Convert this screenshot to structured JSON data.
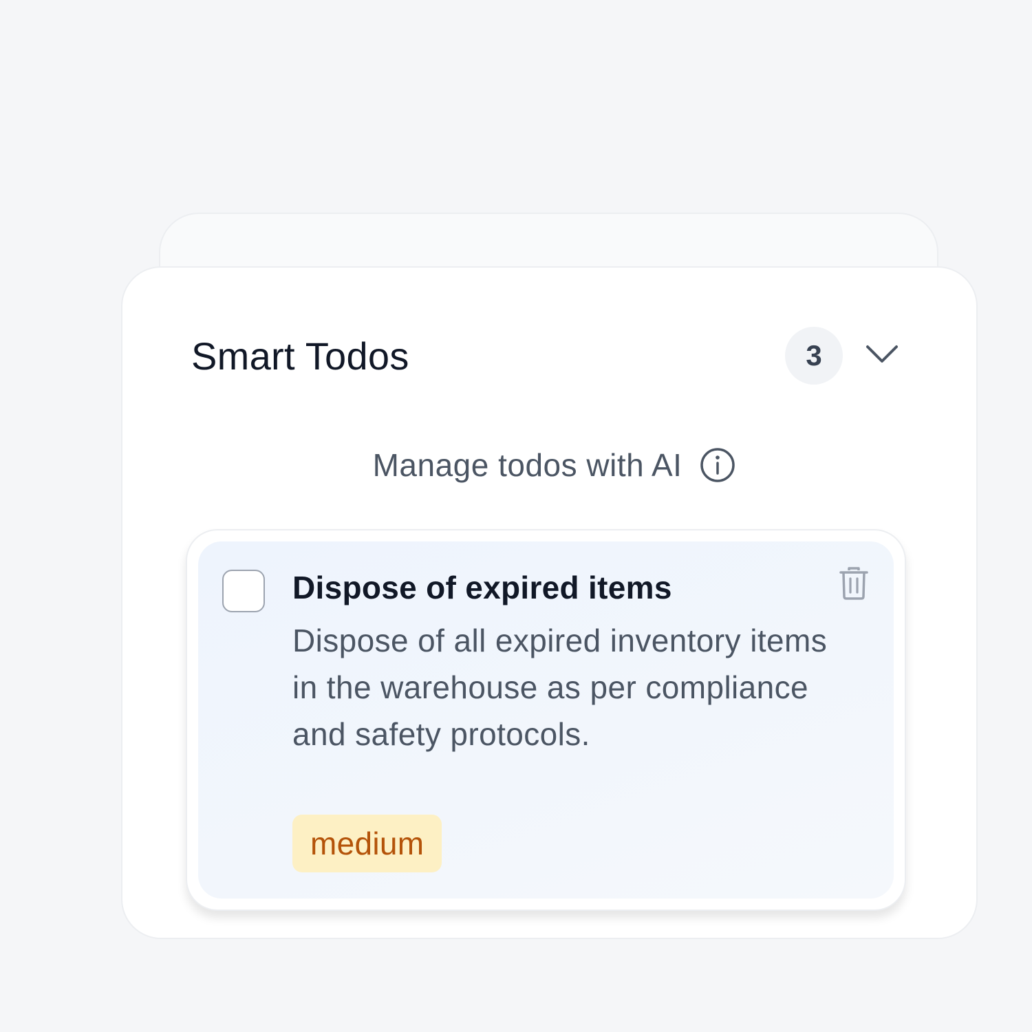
{
  "panel": {
    "title": "Smart Todos",
    "count": "3",
    "subtitle": "Manage todos with AI"
  },
  "icons": {
    "collapse": "chevron-down-icon",
    "info": "info-icon",
    "delete": "trash-icon"
  },
  "todos": [
    {
      "title": "Dispose of expired items",
      "description": "Dispose of all expired inventory items in the warehouse as per compliance and safety protocols.",
      "priority": "medium",
      "completed": false
    }
  ],
  "colors": {
    "priority_medium_bg": "#fdf0c4",
    "priority_medium_text": "#b45309",
    "card_bg": "#eef4fd"
  }
}
